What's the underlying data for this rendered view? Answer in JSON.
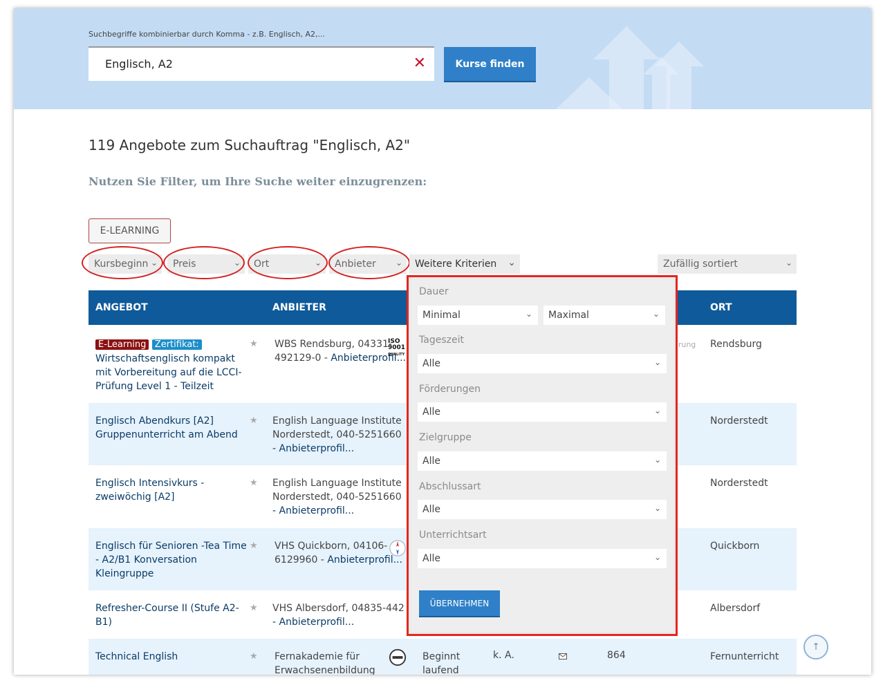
{
  "search": {
    "hint": "Suchbegriffe kombinierbar durch Komma - z.B. Englisch, A2,...",
    "value": "Englisch, A2",
    "clear_symbol": "✕",
    "submit_label": "Kurse finden"
  },
  "results": {
    "title": "119 Angebote zum Suchauftrag \"Englisch, A2\"",
    "filter_hint": "Nutzen Sie Filter, um Ihre Suche weiter einzugrenzen:"
  },
  "filters": {
    "elearning_label": "E-LEARNING",
    "kursbeginn": "Kursbeginn",
    "preis": "Preis",
    "ort": "Ort",
    "anbieter": "Anbieter",
    "weitere": "Weitere Kriterien",
    "sort": "Zufällig sortiert"
  },
  "table": {
    "headers": {
      "angebot": "ANGEBOT",
      "anbieter": "ANBIETER",
      "ort": "ORT"
    },
    "rows": [
      {
        "badge1": "E-Learning",
        "badge2": "Zertifikat:",
        "title": "Wirtschaftsenglisch kompakt mit Vorbereitung auf die LCCI-Prüfung Level 1 - Teilzeit",
        "provider": "WBS Rendsburg, 04331-492129-0 -",
        "provider_link": "Anbieterprofil...",
        "place": "Rendsburg",
        "extra": "lerung"
      },
      {
        "title": "Englisch Abendkurs [A2] Gruppenunterricht am Abend",
        "provider": "English Language Institute Norderstedt, 040-5251660",
        "provider_link": "- Anbieterprofil...",
        "place": "Norderstedt"
      },
      {
        "title": "Englisch Intensivkurs - zweiwöchig [A2]",
        "provider": "English Language Institute Norderstedt, 040-5251660",
        "provider_link": "- Anbieterprofil...",
        "place": "Norderstedt"
      },
      {
        "title": "Englisch für Senioren -Tea Time - A2/B1 Konversation Kleingruppe",
        "provider": "VHS Quickborn, 04106-6129960 -",
        "provider_link": "Anbieterprofil...",
        "place": "Quickborn"
      },
      {
        "title": "Refresher-Course II (Stufe A2-B1)",
        "provider": "VHS Albersdorf, 04835-442",
        "provider_link": "- Anbieterprofil...",
        "place": "Albersdorf"
      },
      {
        "title": "Technical English",
        "provider": "Fernakademie für Erwachsenenbildung",
        "beginn": "Beginnt laufend",
        "dauer": "k. A.",
        "preis": "864",
        "place": "Fernunterricht"
      }
    ],
    "star": "★"
  },
  "popup": {
    "dauer_label": "Dauer",
    "dauer_min": "Minimal",
    "dauer_max": "Maximal",
    "tageszeit_label": "Tageszeit",
    "tageszeit_value": "Alle",
    "foerderungen_label": "Förderungen",
    "foerderungen_value": "Alle",
    "zielgruppe_label": "Zielgruppe",
    "zielgruppe_value": "Alle",
    "abschluss_label": "Abschlussart",
    "abschluss_value": "Alle",
    "unterricht_label": "Unterrichtsart",
    "unterricht_value": "Alle",
    "apply_label": "ÜBERNEHMEN"
  },
  "logos": {
    "iso_top": "ISO",
    "iso_num": "9001",
    "iso_sub": "QUALITY"
  },
  "scroll_top_symbol": "↑",
  "chevron": "⌄",
  "colors": {
    "accent": "#2f80c8",
    "header": "#0f5a9a",
    "highlight": "#e3261f"
  }
}
